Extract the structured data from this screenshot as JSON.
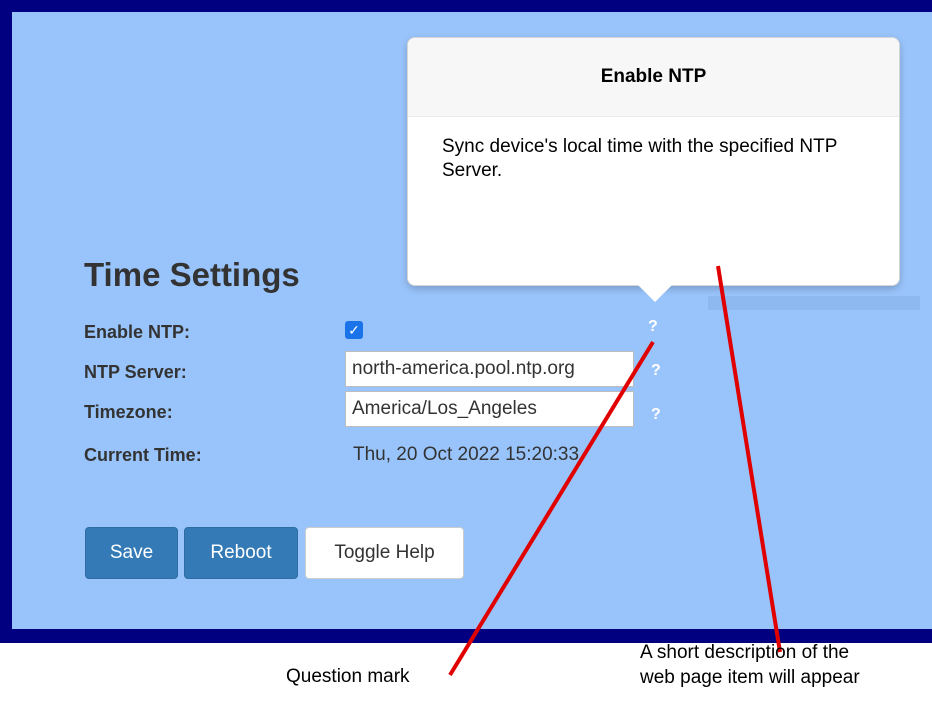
{
  "popover": {
    "title": "Enable NTP",
    "body": "Sync device's local time with the specified NTP Server."
  },
  "page": {
    "title": "Time Settings"
  },
  "form": {
    "enable_ntp": {
      "label": "Enable NTP:",
      "checked": true,
      "check_glyph": "✓",
      "help": "?"
    },
    "ntp_server": {
      "label": "NTP Server:",
      "value": "north-america.pool.ntp.org",
      "help": "?"
    },
    "timezone": {
      "label": "Timezone:",
      "value": "America/Los_Angeles",
      "help": "?"
    },
    "current_time": {
      "label": "Current Time:",
      "value": "Thu, 20 Oct 2022 15:20:33"
    }
  },
  "buttons": {
    "save": "Save",
    "reboot": "Reboot",
    "toggle_help": "Toggle Help"
  },
  "annotations": {
    "question_mark": "Question mark",
    "description_line1": "A short description of the",
    "description_line2": "web page item will appear"
  },
  "colors": {
    "frame": "#000080",
    "panel": "#99c4fb",
    "primary_button": "#337ab7",
    "checkbox": "#1a73e8",
    "callout_line": "#e00000"
  }
}
